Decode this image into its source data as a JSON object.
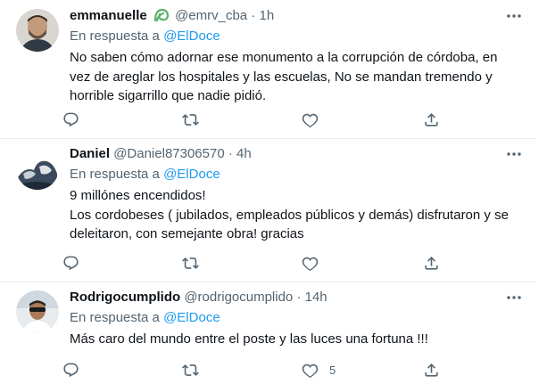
{
  "tweets": [
    {
      "name": "emmanuelle",
      "handle": "@emrv_cba",
      "dot": "·",
      "time": "1h",
      "reply_prefix": "En respuesta a",
      "reply_mention": "@ElDoce",
      "body": [
        "No saben cómo adornar ese monumento a la corrupción de córdoba, en vez de areglar los hospitales y las escuelas, No se mandan tremendo y horrible sigarrillo que nadie pidió."
      ],
      "like_count": ""
    },
    {
      "name": "Daniel",
      "handle": "@Daniel87306570",
      "dot": "·",
      "time": "4h",
      "reply_prefix": "En respuesta a",
      "reply_mention": "@ElDoce",
      "body": [
        "9 millónes encendidos!",
        "Los cordobeses (  jubilados, empleados públicos y demás) disfrutaron y se deleitaron, con semejante obra! gracias"
      ],
      "like_count": ""
    },
    {
      "name": "Rodrigocumplido",
      "handle": "@rodrigocumplido",
      "dot": "·",
      "time": "14h",
      "reply_prefix": "En respuesta a",
      "reply_mention": "@ElDoce",
      "body": [
        "Más caro del mundo entre el poste y las luces una fortuna !!!"
      ],
      "like_count": "5"
    }
  ],
  "colors": {
    "text": "#0f1419",
    "secondary": "#536471",
    "link": "#1d9bf0",
    "verified_badge": "#59b36a",
    "divider": "#e6ecf0"
  },
  "icons": {
    "verified": "leaf-badge-icon",
    "more": "more-dots-icon",
    "reply": "reply-icon",
    "retweet": "retweet-icon",
    "like": "heart-icon",
    "share": "share-icon"
  }
}
